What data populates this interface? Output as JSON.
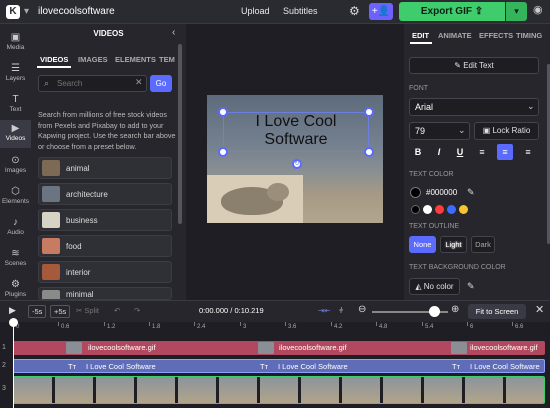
{
  "header": {
    "project_title": "ilovecoolsoftware",
    "upload_label": "Upload",
    "subtitles_label": "Subtitles",
    "export_label": "Export GIF ⇪"
  },
  "rail": {
    "items": [
      {
        "label": "Media",
        "icon": "media-icon"
      },
      {
        "label": "Layers",
        "icon": "layers-icon"
      },
      {
        "label": "Text",
        "icon": "text-icon"
      },
      {
        "label": "Videos",
        "icon": "video-icon"
      },
      {
        "label": "Images",
        "icon": "images-icon"
      },
      {
        "label": "Elements",
        "icon": "elements-icon"
      },
      {
        "label": "Audio",
        "icon": "audio-icon"
      },
      {
        "label": "Scenes",
        "icon": "scenes-icon"
      },
      {
        "label": "Plugins",
        "icon": "plugins-icon"
      }
    ]
  },
  "panel": {
    "heading": "VIDEOS",
    "tabs": [
      "VIDEOS",
      "IMAGES",
      "ELEMENTS",
      "TEM"
    ],
    "search_placeholder": "Search",
    "go_label": "Go",
    "description": "Search from millions of free stock videos from Pexels and Pixabay to add to your Kapwing project. Use the search bar above or choose from a preset below.",
    "categories": [
      "animal",
      "architecture",
      "business",
      "food",
      "interior",
      "minimal"
    ]
  },
  "canvas": {
    "text": "I Love Cool Software"
  },
  "right": {
    "tabs": [
      "EDIT",
      "ANIMATE",
      "EFFECTS",
      "TIMING"
    ],
    "edit_text_label": "✎ Edit Text",
    "font_heading": "FONT",
    "font_value": "Arial",
    "size_value": "79",
    "lock_ratio_label": "Lock Ratio",
    "text_color_heading": "TEXT COLOR",
    "color_value": "#000000",
    "text_outline_heading": "TEXT OUTLINE",
    "outline_options": [
      "None",
      "Light",
      "Dark"
    ],
    "text_bg_heading": "TEXT BACKGROUND COLOR",
    "no_color_label": "No color",
    "swatches": [
      "#000000",
      "#ffffff",
      "#ff3b3b",
      "#3b6bff",
      "#f5c531"
    ]
  },
  "timeline": {
    "skip_back": "-5s",
    "skip_fwd": "+5s",
    "split_label": "Split",
    "time_display": "0:00.000 / 0:10.219",
    "fit_label": "Fit to Screen",
    "ticks": [
      "0",
      "0.6",
      "1.2",
      "1.8",
      "2.4",
      "3",
      "3.6",
      "4.2",
      "4.8",
      "5.4",
      "6",
      "6.6"
    ],
    "track_numbers": [
      "1",
      "2",
      "3"
    ],
    "gif_clip_label": "ilovecoolsoftware.gif",
    "text_clip_label": "I Love Cool Software"
  }
}
